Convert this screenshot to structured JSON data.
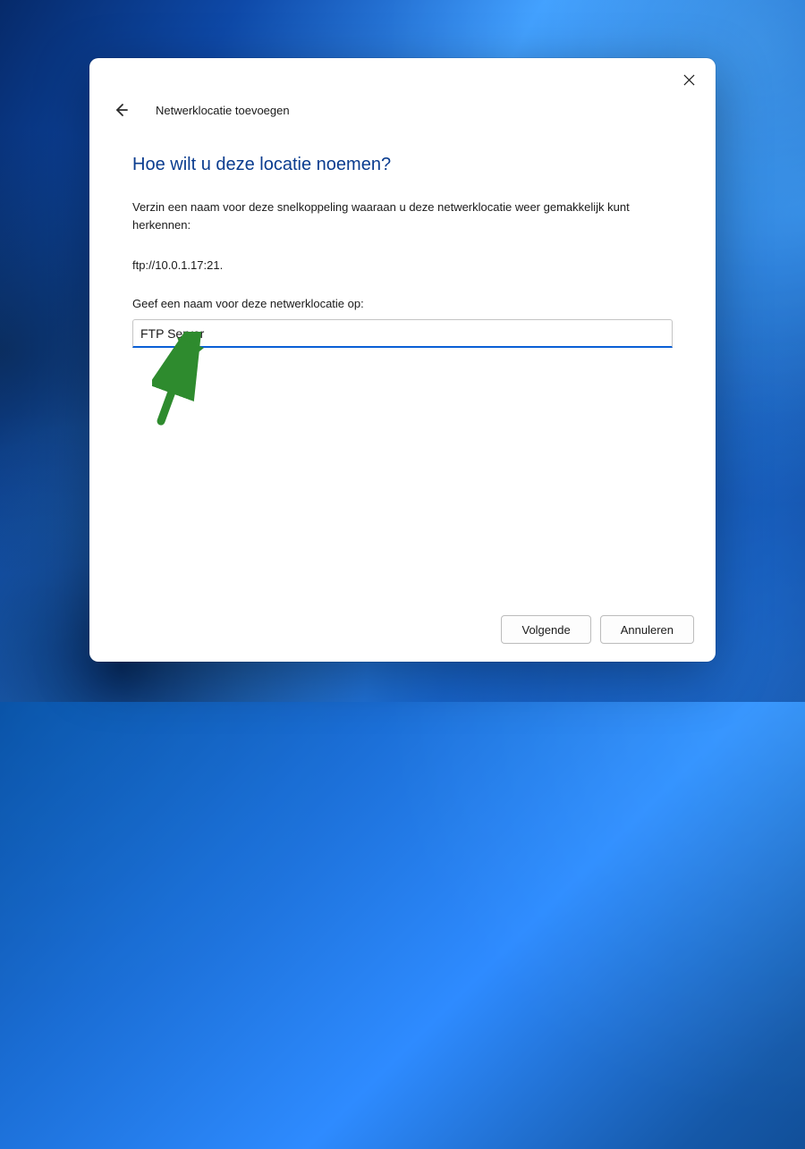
{
  "dialog": {
    "wizard_title": "Netwerklocatie toevoegen",
    "heading": "Hoe wilt u deze locatie noemen?",
    "instruction": "Verzin een naam voor deze snelkoppeling waaraan u deze netwerklocatie weer gemakkelijk kunt herkennen:",
    "address": "ftp://10.0.1.17:21.",
    "input_label": "Geef een naam voor deze netwerklocatie op:",
    "input_value": "FTP Server",
    "buttons": {
      "next": "Volgende",
      "cancel": "Annuleren"
    }
  },
  "icons": {
    "back": "arrow-left",
    "close": "x"
  },
  "colors": {
    "accent": "#0a5fd6",
    "heading": "#0a3c8f",
    "arrow": "#2e8b2e"
  }
}
